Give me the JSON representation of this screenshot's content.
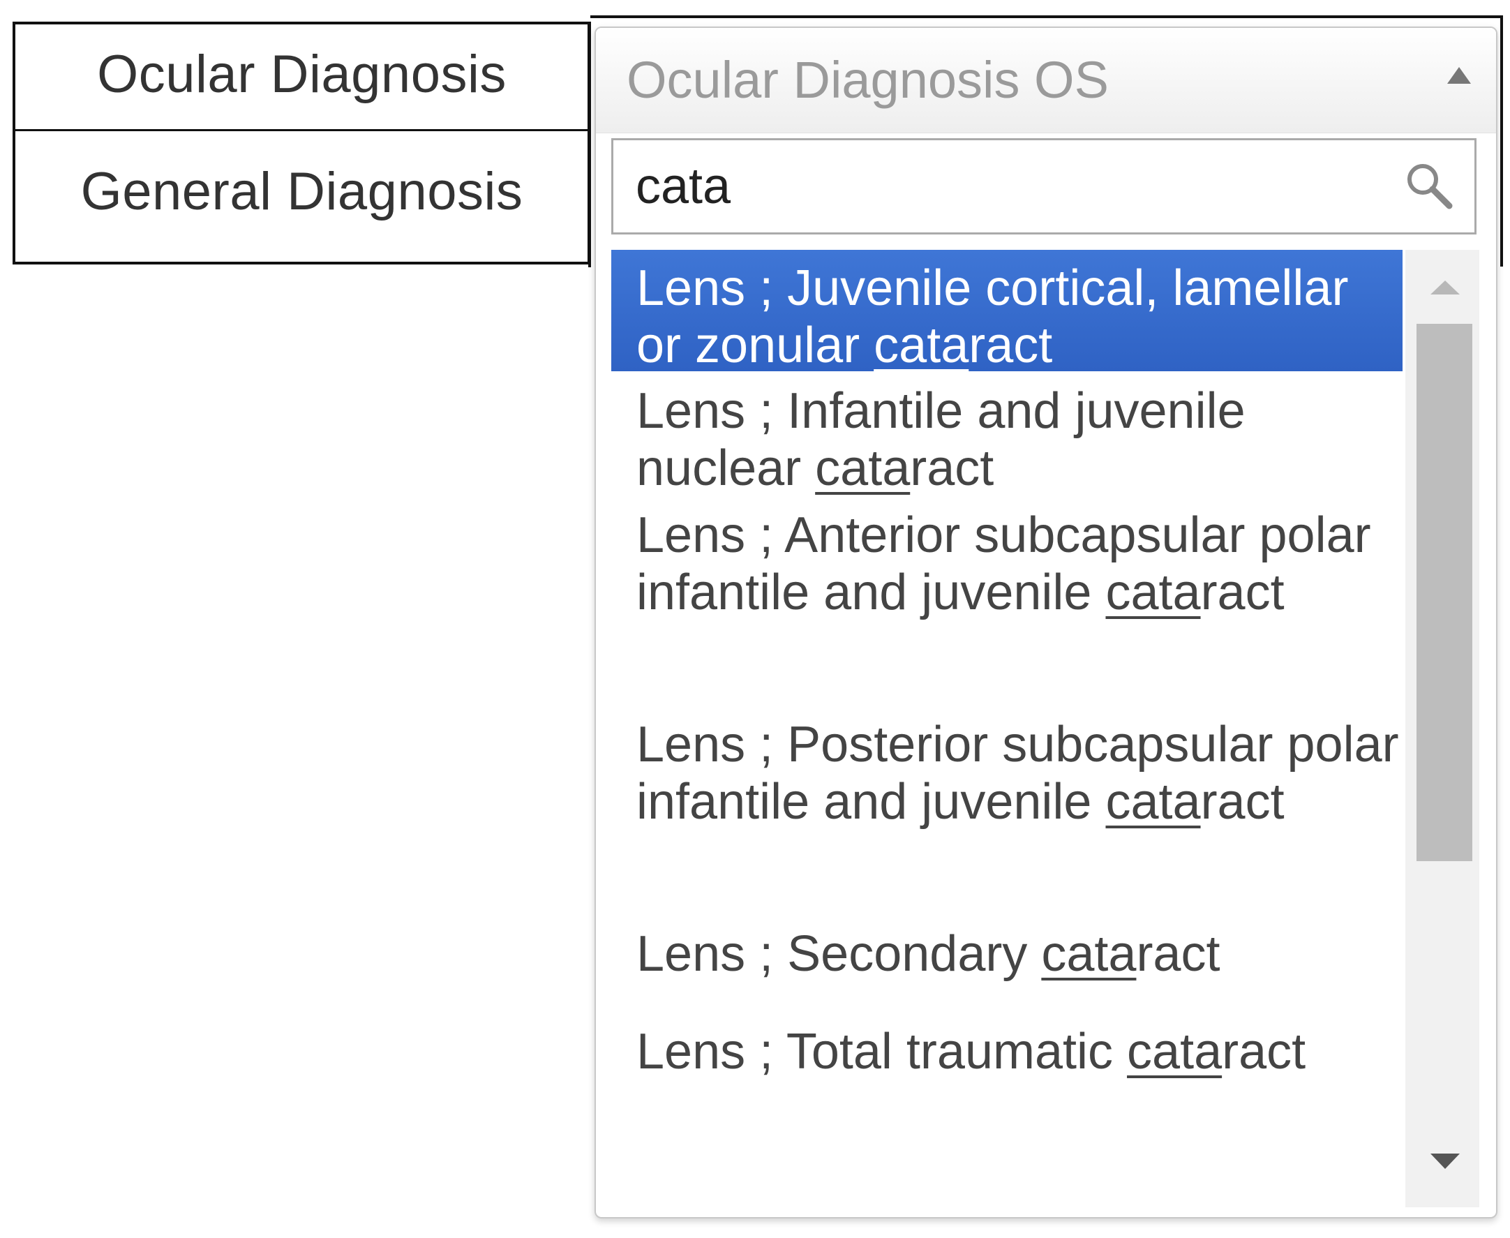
{
  "form": {
    "rows": [
      {
        "label": "Ocular Diagnosis"
      },
      {
        "label": "General Diagnosis"
      }
    ]
  },
  "dropdown": {
    "title": "Ocular Diagnosis OS",
    "caret_icon": "caret-up-icon",
    "search": {
      "value": "cata",
      "icon": "search-icon"
    },
    "results": [
      {
        "prefix": "Lens ; Juvenile cortical, lamellar or zonular ",
        "match": "cata",
        "suffix": "ract",
        "highlighted": true
      },
      {
        "prefix": "Lens ; Infantile and juvenile nuclear ",
        "match": "cata",
        "suffix": "ract",
        "highlighted": false
      },
      {
        "prefix": "Lens ; Anterior subcapsular polar infantile and juvenile ",
        "match": "cata",
        "suffix": "ract",
        "highlighted": false
      },
      {
        "prefix": "Lens ; Posterior subcapsular polar infantile and juvenile ",
        "match": "cata",
        "suffix": "ract",
        "highlighted": false
      },
      {
        "prefix": "Lens ; Secondary ",
        "match": "cata",
        "suffix": "ract",
        "highlighted": false
      },
      {
        "prefix": "Lens ; Total traumatic ",
        "match": "cata",
        "suffix": "ract",
        "highlighted": false
      }
    ],
    "colors": {
      "highlight": "#3a6fd0",
      "highlight_text": "#ffffff",
      "item_text": "#444444"
    }
  }
}
